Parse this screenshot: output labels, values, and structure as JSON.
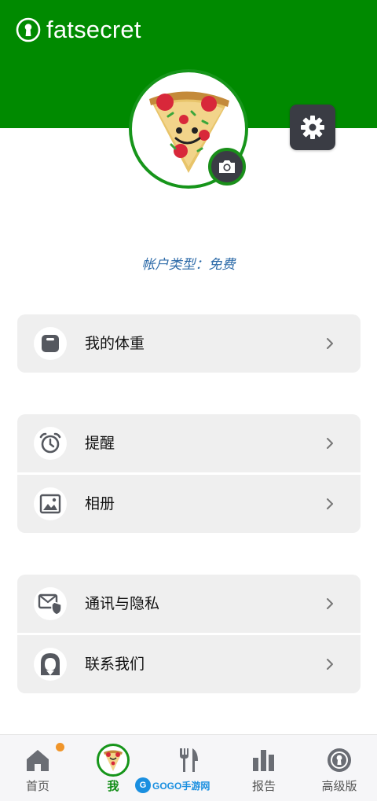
{
  "app": {
    "name": "fatsecret"
  },
  "header": {
    "icons": {
      "logo": "keyhole-logo-icon",
      "camera": "camera-icon",
      "settings": "gear-icon"
    }
  },
  "profile": {
    "account_type": "帐户类型：免费"
  },
  "menu_groups": [
    {
      "items": [
        {
          "label": "我的体重",
          "icon": "scale-icon"
        }
      ]
    },
    {
      "items": [
        {
          "label": "提醒",
          "icon": "alarm-clock-icon"
        },
        {
          "label": "相册",
          "icon": "photo-album-icon"
        }
      ]
    },
    {
      "items": [
        {
          "label": "通讯与隐私",
          "icon": "mail-shield-icon"
        },
        {
          "label": "联系我们",
          "icon": "support-agent-icon"
        }
      ]
    }
  ],
  "bottom_nav": {
    "items": [
      {
        "label": "首页",
        "icon": "home-icon",
        "badge": true
      },
      {
        "label": "我",
        "icon": "pizza-avatar-icon",
        "active": true
      },
      {
        "label": "",
        "icon": "fork-knife-icon"
      },
      {
        "label": "报告",
        "icon": "bar-chart-icon"
      },
      {
        "label": "高级版",
        "icon": "premium-badge-icon"
      }
    ]
  },
  "watermark": {
    "text": "GOGO手游网"
  },
  "colors": {
    "brand_green": "#008a00",
    "dark_button": "#3a3c44",
    "account_type_blue": "#2c6aa8",
    "row_bg": "#efefef",
    "badge_orange": "#f0952a"
  }
}
